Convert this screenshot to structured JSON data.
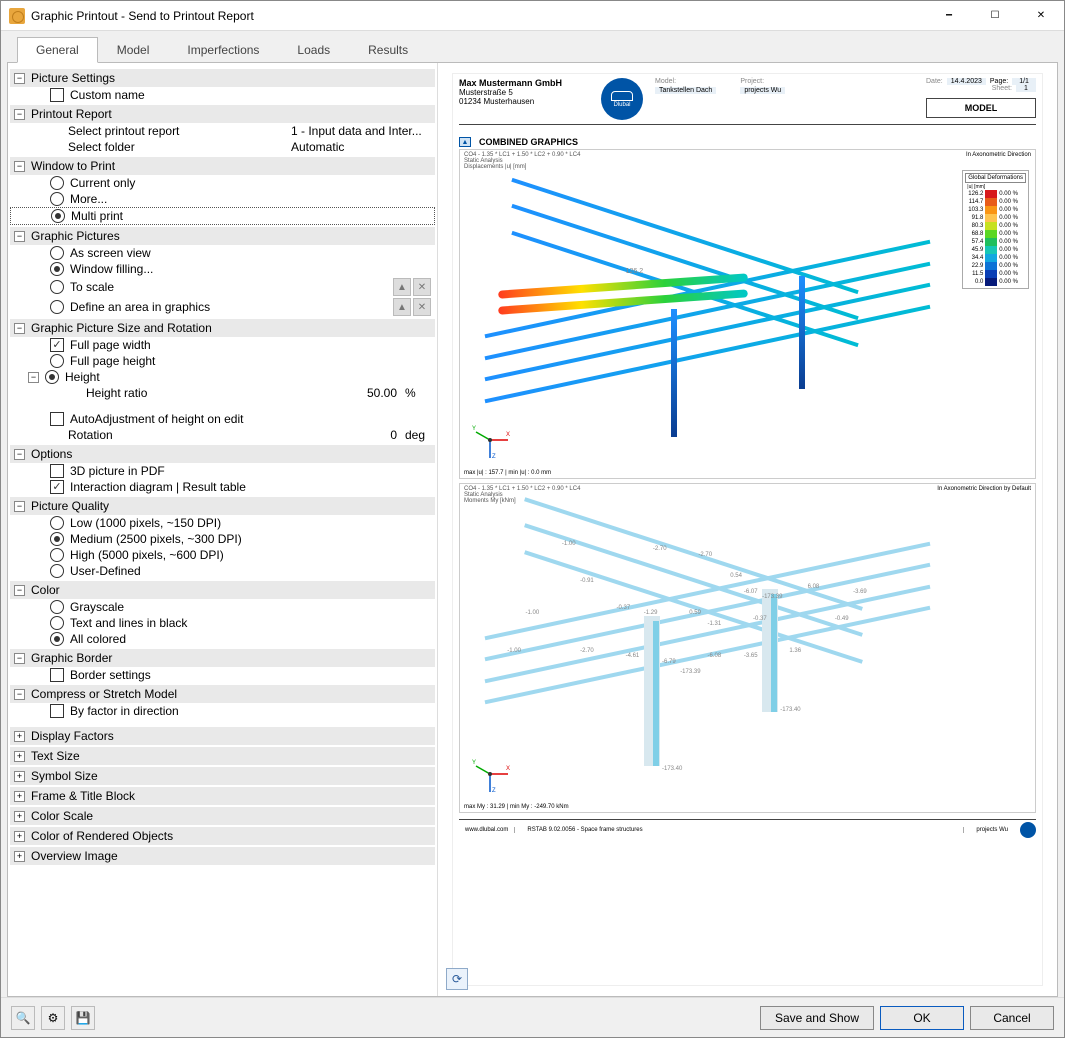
{
  "window": {
    "title": "Graphic Printout - Send to Printout Report"
  },
  "tabs": [
    "General",
    "Model",
    "Imperfections",
    "Loads",
    "Results"
  ],
  "active_tab": 0,
  "tree": {
    "picture_settings": {
      "title": "Picture Settings",
      "custom_name": {
        "label": "Custom name",
        "checked": false
      }
    },
    "printout_report": {
      "title": "Printout Report",
      "select_report": {
        "label": "Select printout report",
        "value": "1 - Input data and Inter..."
      },
      "select_folder": {
        "label": "Select folder",
        "value": "Automatic"
      }
    },
    "window_to_print": {
      "title": "Window to Print",
      "current_only": {
        "label": "Current only",
        "checked": false
      },
      "more": {
        "label": "More...",
        "checked": false
      },
      "multi_print": {
        "label": "Multi print",
        "checked": true
      }
    },
    "graphic_pictures": {
      "title": "Graphic Pictures",
      "as_screen": {
        "label": "As screen view",
        "checked": false
      },
      "window_filling": {
        "label": "Window filling...",
        "checked": true
      },
      "to_scale": {
        "label": "To scale",
        "checked": false
      },
      "define_area": {
        "label": "Define an area in graphics",
        "checked": false
      }
    },
    "size_rotation": {
      "title": "Graphic Picture Size and Rotation",
      "full_width": {
        "label": "Full page width",
        "checked": true
      },
      "full_height": {
        "label": "Full page height",
        "checked": false
      },
      "height": {
        "label": "Height",
        "checked": true
      },
      "height_ratio": {
        "label": "Height ratio",
        "value": "50.00",
        "unit": "%"
      },
      "auto_adjust": {
        "label": "AutoAdjustment of height on edit",
        "checked": false
      },
      "rotation": {
        "label": "Rotation",
        "value": "0",
        "unit": "deg"
      }
    },
    "options": {
      "title": "Options",
      "pic3d": {
        "label": "3D picture in PDF",
        "checked": false
      },
      "interaction": {
        "label": "Interaction diagram | Result table",
        "checked": true
      }
    },
    "quality": {
      "title": "Picture Quality",
      "low": {
        "label": "Low (1000 pixels, ~150 DPI)",
        "checked": false
      },
      "medium": {
        "label": "Medium (2500 pixels, ~300 DPI)",
        "checked": true
      },
      "high": {
        "label": "High (5000 pixels, ~600 DPI)",
        "checked": false
      },
      "user": {
        "label": "User-Defined",
        "checked": false
      }
    },
    "color": {
      "title": "Color",
      "grayscale": {
        "label": "Grayscale",
        "checked": false
      },
      "text_black": {
        "label": "Text and lines in black",
        "checked": false
      },
      "all_colored": {
        "label": "All colored",
        "checked": true
      }
    },
    "border": {
      "title": "Graphic Border",
      "border_settings": {
        "label": "Border settings",
        "checked": false
      }
    },
    "compress": {
      "title": "Compress or Stretch Model",
      "by_factor": {
        "label": "By factor in direction",
        "checked": false
      }
    },
    "collapsed": [
      "Display Factors",
      "Text Size",
      "Symbol Size",
      "Frame & Title Block",
      "Color Scale",
      "Color of Rendered Objects",
      "Overview Image"
    ]
  },
  "preview": {
    "company": "Max Mustermann GmbH",
    "addr1": "Musterstraße 5",
    "addr2": "01234 Musterhausen",
    "logo_text": "Dlubal",
    "model_lbl": "Model:",
    "model_val": "Tankstellen Dach",
    "project_lbl": "Project:",
    "project_val": "projects Wu",
    "date_lbl": "Date:",
    "date_val": "14.4.2023",
    "page_lbl": "Page:",
    "page_val": "1/1",
    "sheet_lbl": "Sheet:",
    "sheet_val": "1",
    "big_label": "MODEL",
    "section_title": "COMBINED GRAPHICS",
    "chart1": {
      "line1": "CO4 - 1.35 * LC1 + 1.50 * LC2 + 0.90 * LC4",
      "line2": "Static Analysis",
      "line3": "Displacements |u| [mm]",
      "right": "In Axonometric Direction",
      "footer": "max |u| : 157.7 | min |u| : 0.0 mm",
      "legend_title": "Global Deformations",
      "legend_sub": "|u| [mm]",
      "legend": [
        {
          "v": "126.2",
          "c": "#d7191c",
          "p": "0.00 %"
        },
        {
          "v": "114.7",
          "c": "#e85b19",
          "p": "0.00 %"
        },
        {
          "v": "103.3",
          "c": "#f99515",
          "p": "0.00 %"
        },
        {
          "v": "91.8",
          "c": "#fec44f",
          "p": "0.00 %"
        },
        {
          "v": "80.3",
          "c": "#c7e120",
          "p": "0.00 %"
        },
        {
          "v": "68.8",
          "c": "#5bd724",
          "p": "0.00 %"
        },
        {
          "v": "57.4",
          "c": "#1fbf5d",
          "p": "0.00 %"
        },
        {
          "v": "45.9",
          "c": "#17c7b5",
          "p": "0.00 %"
        },
        {
          "v": "34.4",
          "c": "#12a8e0",
          "p": "0.00 %"
        },
        {
          "v": "22.9",
          "c": "#0d73d6",
          "p": "0.00 %"
        },
        {
          "v": "11.5",
          "c": "#0a3fb5",
          "p": "0.00 %"
        },
        {
          "v": "0.0",
          "c": "#061a7a",
          "p": "0.00 %"
        }
      ],
      "value_label": "126.2"
    },
    "chart2": {
      "line1": "CO4 - 1.35 * LC1 + 1.50 * LC2 + 0.90 * LC4",
      "line2": "Static Analysis",
      "line3": "Moments My [kNm]",
      "right": "In Axonometric Direction by Default",
      "footer": "max My : 31.29 | min My : -249.70 kNm",
      "labels": [
        "-1.00",
        "-2.70",
        "-2.70",
        "0.54",
        "-0.91",
        "-6.07",
        "-173.39",
        "6.08",
        "-3.69",
        "-1.00",
        "-0.37",
        "-1.29",
        "0.59",
        "-1.31",
        "-0.37",
        "-0.49",
        "-1.00",
        "-2.70",
        "-4.61",
        "-6.79",
        "-6.08",
        "-3.65",
        "1.36",
        "-173.39",
        "-173.40",
        "-173.40"
      ]
    },
    "footer_site": "www.dlubal.com",
    "footer_app": "RSTAB 9.02.0056 - Space frame structures",
    "footer_proj": "projects Wu"
  },
  "footer": {
    "save_show": "Save and Show",
    "ok": "OK",
    "cancel": "Cancel"
  }
}
